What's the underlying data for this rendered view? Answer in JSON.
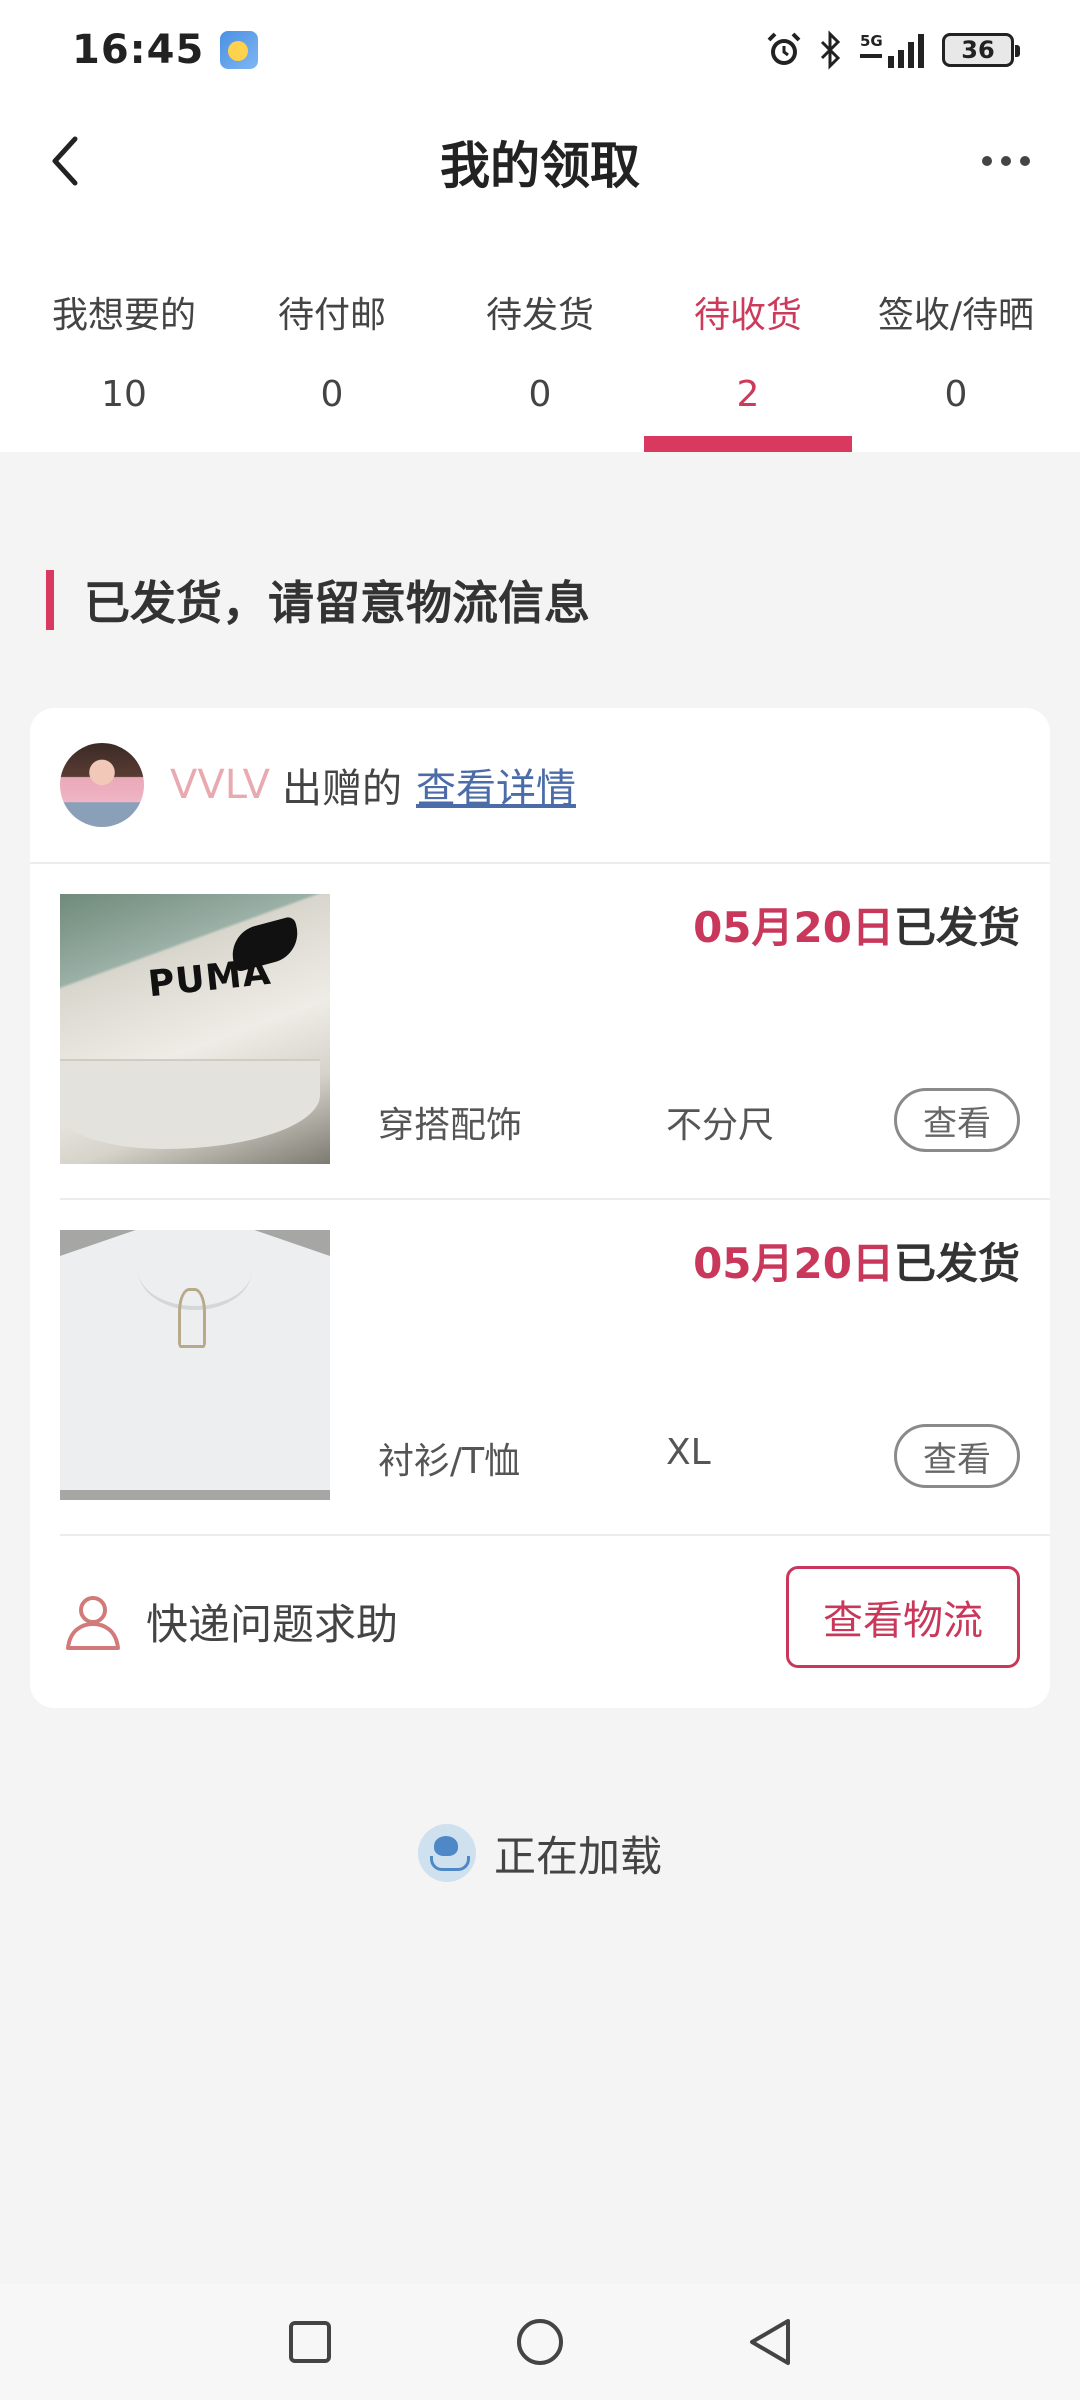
{
  "status_bar": {
    "time": "16:45",
    "network": "5G",
    "battery": "36"
  },
  "header": {
    "title": "我的领取"
  },
  "tabs": [
    {
      "label": "我想要的",
      "count": "10",
      "active": false
    },
    {
      "label": "待付邮",
      "count": "0",
      "active": false
    },
    {
      "label": "待发货",
      "count": "0",
      "active": false
    },
    {
      "label": "待收货",
      "count": "2",
      "active": true
    },
    {
      "label": "签收/待晒",
      "count": "0",
      "active": false
    }
  ],
  "section": {
    "title": "已发货，请留意物流信息"
  },
  "card": {
    "donor_name": "VVLV",
    "donor_suffix": "出赠的",
    "detail_link": "查看详情",
    "items": [
      {
        "ship_date": "05月20日",
        "ship_status": "已发货",
        "category": "穿搭配饰",
        "size": "不分尺",
        "view_label": "查看",
        "thumb_text": "PUMA"
      },
      {
        "ship_date": "05月20日",
        "ship_status": "已发货",
        "category": "衬衫/T恤",
        "size": "XL",
        "view_label": "查看"
      }
    ],
    "help_text": "快递问题求助",
    "logistics_button": "查看物流"
  },
  "loading": {
    "text": "正在加载"
  },
  "colors": {
    "accent": "#d9395e",
    "donor_name": "#e8aab0",
    "link": "#4b6ca8"
  }
}
